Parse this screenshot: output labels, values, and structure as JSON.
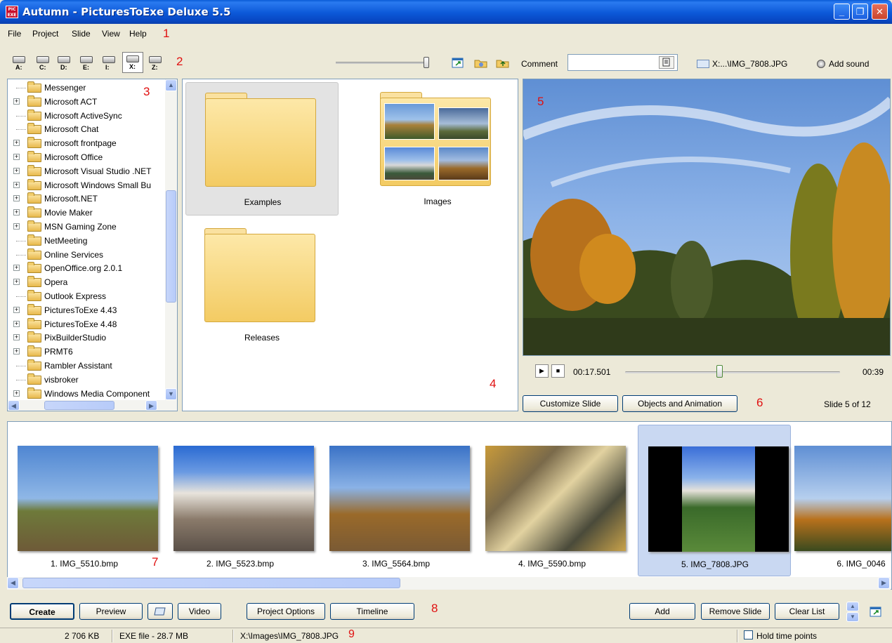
{
  "window": {
    "title": "Autumn - PicturesToExe Deluxe 5.5",
    "icon_text": "PIC EXE",
    "minimize": "_",
    "restore": "❐",
    "close": "✕"
  },
  "menu": [
    "File",
    "Project",
    "Slide",
    "View",
    "Help"
  ],
  "annotations": [
    "1",
    "2",
    "3",
    "4",
    "5",
    "6",
    "7",
    "8",
    "9"
  ],
  "toolbar": {
    "drives": [
      "A:",
      "C:",
      "D:",
      "E:",
      "I:",
      "X:",
      "Z:"
    ],
    "selected_drive": "X:",
    "zoom_slider_level": 0.97,
    "comment_label": "Comment",
    "comment_value": "",
    "file_ref": "X:...\\IMG_7808.JPG",
    "add_sound": "Add sound"
  },
  "tree": {
    "items": [
      {
        "label": "Messenger",
        "expandable": false
      },
      {
        "label": "Microsoft ACT",
        "expandable": true
      },
      {
        "label": "Microsoft ActiveSync",
        "expandable": false
      },
      {
        "label": "Microsoft Chat",
        "expandable": false
      },
      {
        "label": "microsoft frontpage",
        "expandable": true
      },
      {
        "label": "Microsoft Office",
        "expandable": true
      },
      {
        "label": "Microsoft Visual Studio .NET",
        "expandable": true
      },
      {
        "label": "Microsoft Windows Small Bu",
        "expandable": true
      },
      {
        "label": "Microsoft.NET",
        "expandable": true
      },
      {
        "label": "Movie Maker",
        "expandable": true
      },
      {
        "label": "MSN Gaming Zone",
        "expandable": true
      },
      {
        "label": "NetMeeting",
        "expandable": false
      },
      {
        "label": "Online Services",
        "expandable": false
      },
      {
        "label": "OpenOffice.org 2.0.1",
        "expandable": true
      },
      {
        "label": "Opera",
        "expandable": true
      },
      {
        "label": "Outlook Express",
        "expandable": false
      },
      {
        "label": "PicturesToExe 4.43",
        "expandable": true
      },
      {
        "label": "PicturesToExe 4.48",
        "expandable": true
      },
      {
        "label": "PixBuilderStudio",
        "expandable": true
      },
      {
        "label": "PRMT6",
        "expandable": true
      },
      {
        "label": "Rambler Assistant",
        "expandable": false
      },
      {
        "label": "visbroker",
        "expandable": false
      },
      {
        "label": "Windows Media Component",
        "expandable": true
      }
    ]
  },
  "explorer": {
    "folders": [
      {
        "label": "Examples",
        "selected": true,
        "has_thumbs": false
      },
      {
        "label": "Images",
        "selected": false,
        "has_thumbs": true
      },
      {
        "label": "Releases",
        "selected": false,
        "has_thumbs": false
      }
    ]
  },
  "player": {
    "current_time": "00:17.501",
    "total_time": "00:39",
    "position_fraction": 0.44,
    "play": "▶",
    "stop": "■"
  },
  "slide_actions": {
    "customize": "Customize Slide",
    "objects": "Objects and Animation",
    "slide_counter": "Slide 5 of 12"
  },
  "slides": [
    {
      "label": "1. IMG_5510.bmp",
      "selected": false
    },
    {
      "label": "2. IMG_5523.bmp",
      "selected": false
    },
    {
      "label": "3. IMG_5564.bmp",
      "selected": false
    },
    {
      "label": "4. IMG_5590.bmp",
      "selected": false
    },
    {
      "label": "5. IMG_7808.JPG",
      "selected": true
    },
    {
      "label": "6. IMG_0046",
      "selected": false
    }
  ],
  "bottom_buttons": {
    "create": "Create",
    "preview": "Preview",
    "video": "Video",
    "project_options": "Project Options",
    "timeline": "Timeline",
    "add": "Add",
    "remove_slide": "Remove Slide",
    "clear_list": "Clear List"
  },
  "status": {
    "size": "2 706 KB",
    "exe_file": "EXE file - 28.7 MB",
    "path": "X:\\Images\\IMG_7808.JPG",
    "hold_time_points": "Hold time points",
    "hold_checked": false
  },
  "colors": {
    "titlebar": "#0a4fd0",
    "accent_red": "#e01010",
    "selection": "#c9d8f2",
    "window_bg": "#ece9d8"
  }
}
